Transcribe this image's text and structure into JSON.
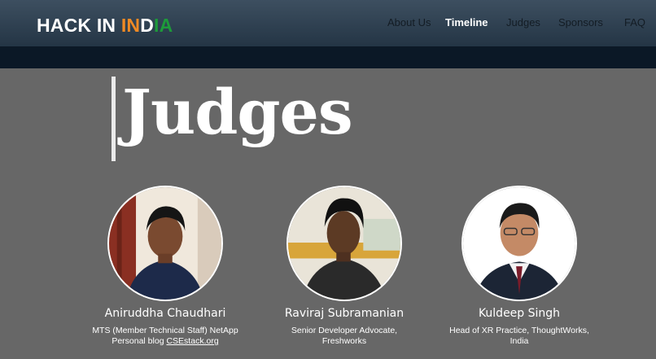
{
  "header": {
    "logo": {
      "part1": "HACK IN ",
      "part2": "I",
      "part3": "N",
      "part4": "D",
      "part5": "IA"
    },
    "nav": [
      {
        "label": "About Us"
      },
      {
        "label": "Timeline"
      },
      {
        "label": "Judges"
      },
      {
        "label": "Sponsors"
      },
      {
        "label": "FAQ"
      }
    ]
  },
  "page": {
    "title": "Judges"
  },
  "judges": [
    {
      "name": "Aniruddha Chaudhari",
      "role_line1": "MTS (Member Technical Staff) NetApp",
      "role_line2_prefix": "Personal blog ",
      "role_link": "CSEstack.org"
    },
    {
      "name": "Raviraj Subramanian",
      "role_line1": "Senior Developer Advocate,",
      "role_line2": "Freshworks"
    },
    {
      "name": "Kuldeep Singh",
      "role_line1": "Head of XR Practice, ThoughtWorks,",
      "role_line2": "India"
    }
  ],
  "colors": {
    "page_bg": "#676767",
    "header_bg": "#2f4152",
    "subbar_bg": "#0b1826",
    "logo_saffron": "#f08a24",
    "logo_green": "#1d9a3a"
  }
}
